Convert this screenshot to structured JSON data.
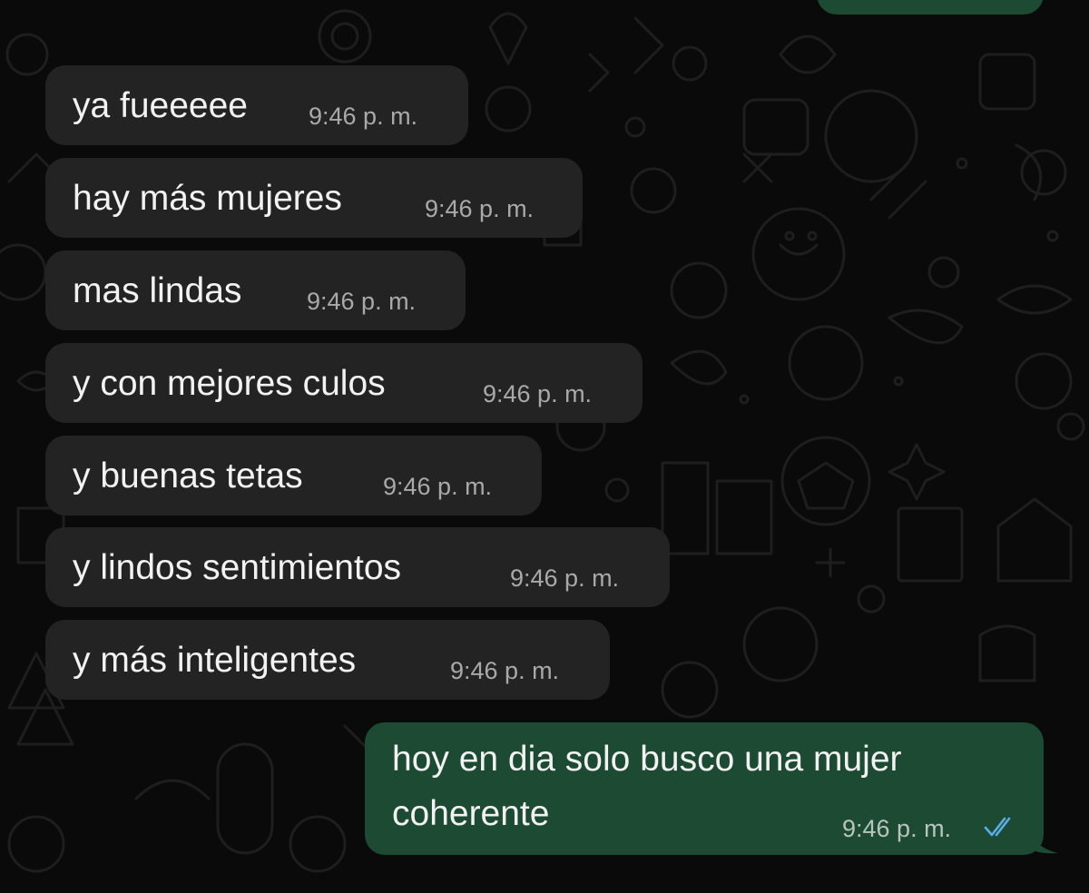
{
  "conversation": {
    "incoming": [
      {
        "text": "ya fueeeee",
        "time": "9:46 p. m."
      },
      {
        "text": "hay más mujeres",
        "time": "9:46 p. m."
      },
      {
        "text": "mas lindas",
        "time": "9:46 p. m."
      },
      {
        "text": "y con mejores culos",
        "time": "9:46 p. m."
      },
      {
        "text": "y buenas tetas",
        "time": "9:46 p. m."
      },
      {
        "text": "y lindos sentimientos",
        "time": "9:46 p. m."
      },
      {
        "text": "y más inteligentes",
        "time": "9:46 p. m."
      }
    ],
    "outgoing": {
      "line1": "hoy en dia solo busco una mujer",
      "line2": "coherente",
      "time": "9:46 p. m.",
      "status_icon": "double-check-read-icon",
      "read_color": "#5aaee8"
    }
  },
  "colors": {
    "background": "#0a0a0a",
    "incoming_bubble": "#232323",
    "outgoing_bubble": "#1c4a33"
  }
}
